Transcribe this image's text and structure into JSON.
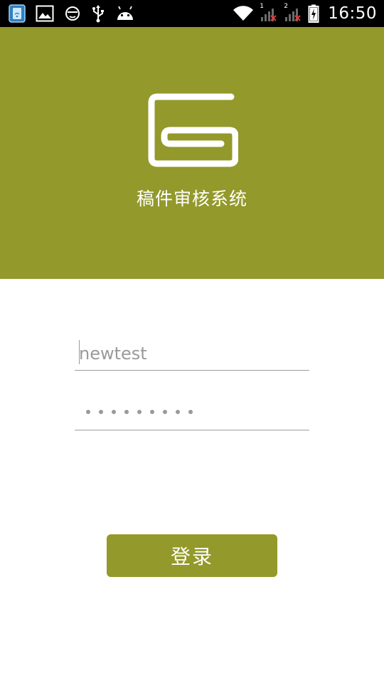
{
  "status_bar": {
    "time": "16:50",
    "left_icons": [
      "sim-toolkit-icon",
      "gallery-icon",
      "face-icon",
      "usb-icon",
      "android-icon"
    ],
    "right_icons": [
      "wifi-icon",
      "signal-sim1-icon",
      "signal-sim2-icon",
      "battery-icon"
    ],
    "sim1_label": "1",
    "sim2_label": "2"
  },
  "header": {
    "logo": "app-logo-icon",
    "title": "稿件审核系统",
    "color": "#93992a"
  },
  "login_form": {
    "username": {
      "value": "newtest"
    },
    "password": {
      "masked": true,
      "dot_count": 9
    },
    "submit_label": "登录"
  },
  "colors": {
    "accent": "#93992a",
    "text_muted": "#9a9a9a",
    "divider": "#9e9e9e"
  }
}
